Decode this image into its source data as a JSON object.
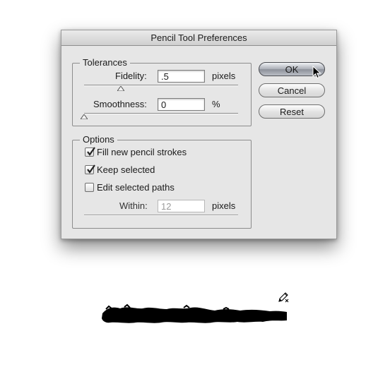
{
  "dialog": {
    "title": "Pencil Tool Preferences",
    "tolerances": {
      "title": "Tolerances",
      "fidelity_label": "Fidelity:",
      "fidelity_value": ".5",
      "fidelity_unit": "pixels",
      "smoothness_label": "Smoothness:",
      "smoothness_value": "0",
      "smoothness_unit": "%"
    },
    "options": {
      "title": "Options",
      "fill_label": "Fill new pencil strokes",
      "fill_checked": true,
      "keep_label": "Keep selected",
      "keep_checked": true,
      "edit_label": "Edit selected paths",
      "edit_checked": false,
      "within_label": "Within:",
      "within_value": "12",
      "within_unit": "pixels"
    },
    "buttons": {
      "ok": "OK",
      "cancel": "Cancel",
      "reset": "Reset"
    }
  },
  "icons": {
    "pencil_cursor": "pencil-cursor-icon",
    "mouse_pointer": "arrow-cursor-icon"
  }
}
